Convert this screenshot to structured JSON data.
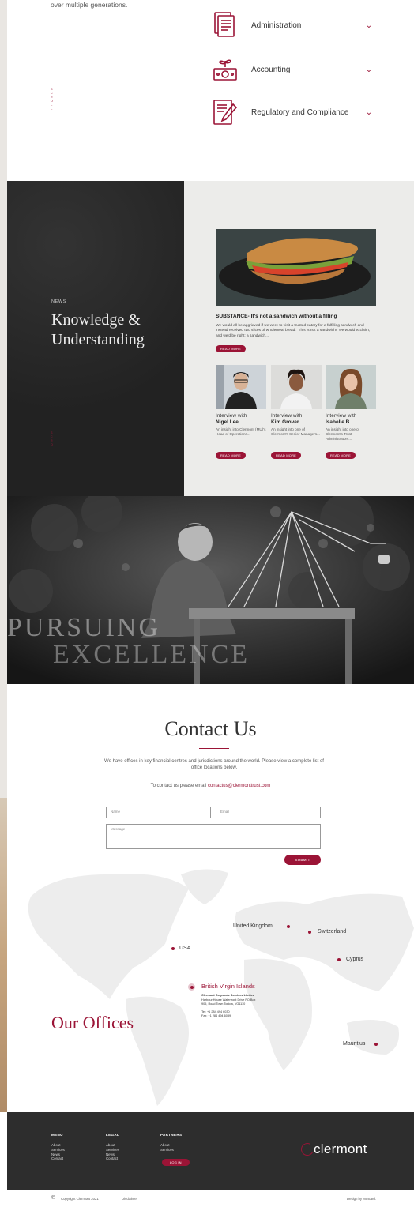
{
  "intro": {
    "text": "over multiple generations."
  },
  "services": {
    "items": [
      {
        "label": "Administration",
        "icon": "document-stack-icon"
      },
      {
        "label": "Accounting",
        "icon": "money-plant-icon"
      },
      {
        "label": "Regulatory and Compliance",
        "icon": "document-pen-icon"
      }
    ],
    "scroll_label": "SCROLL"
  },
  "news": {
    "eyebrow": "NEWS",
    "title_line1": "Knowledge &",
    "title_line2": "Understanding",
    "scroll_label": "SCROLL",
    "featured": {
      "title": "SUBSTANCE- It's not a sandwich without a filling",
      "excerpt": "We would all be aggrieved if we were to visit a trusted eatery for a fulfilling sandwich and instead received two slices of wholemeal bread. \"This is not a sandwich!\" we would exclaim, and we'd be right; a sandwich...",
      "button": "READ MORE"
    },
    "interviews": [
      {
        "line1": "Interview with",
        "name": "Nigel Lee",
        "excerpt": "An insight into Clermont (MU)'s Head of Operations...",
        "button": "READ MORE"
      },
      {
        "line1": "Interview with",
        "name": "Kim Grover",
        "excerpt": "An insight into one of Clermont's Senior Managers...",
        "button": "READ MORE"
      },
      {
        "line1": "Interview with",
        "name": "Isabelle B.",
        "excerpt": "An insight into one of Clermont's Trust Administrators...",
        "button": "READ MORE"
      }
    ]
  },
  "hero": {
    "line1": "PURSUING",
    "line2": "EXCELLENCE"
  },
  "contact": {
    "title": "Contact Us",
    "intro": "We have offices in key financial centres and jurisdictions around the world. Please view a complete list of office locations below.",
    "email_prefix": "To contact us please email ",
    "email": "contactus@clermonttrust.com",
    "name_placeholder": "Name",
    "email_placeholder": "Email",
    "message_placeholder": "Message",
    "submit": "SUBMIT"
  },
  "offices": {
    "title": "Our Offices",
    "locations": [
      "United Kingdom",
      "Switzerland",
      "USA",
      "Cyprus",
      "Mauritius"
    ],
    "active": {
      "name": "British Virgin Islands",
      "company": "Clermont Corporate Services Limited",
      "address1": "Harbour House Waterfront Drive PO Box",
      "address2": "905, Road Town Tortola, VG1110",
      "tel": "Tel: +1 284 494 6030",
      "fax": "Fax: +1 284 494 6039"
    }
  },
  "footer": {
    "menu": {
      "heading": "MENU",
      "items": [
        "About",
        "Services",
        "News",
        "Contact"
      ]
    },
    "legal": {
      "heading": "LEGAL",
      "items": [
        "About",
        "Services",
        "News",
        "Contact"
      ]
    },
    "partners": {
      "heading": "PARTNERS",
      "items": [
        "About",
        "Services"
      ],
      "button": "LOG IN"
    },
    "logo": "clermont",
    "copyright": "Copyright Clermont 2021",
    "disclaimer": "Disclaimer",
    "credit": "Design by Mustard."
  },
  "colors": {
    "accent": "#9b1436",
    "dark": "#242424",
    "footer": "#2d2d2d"
  }
}
